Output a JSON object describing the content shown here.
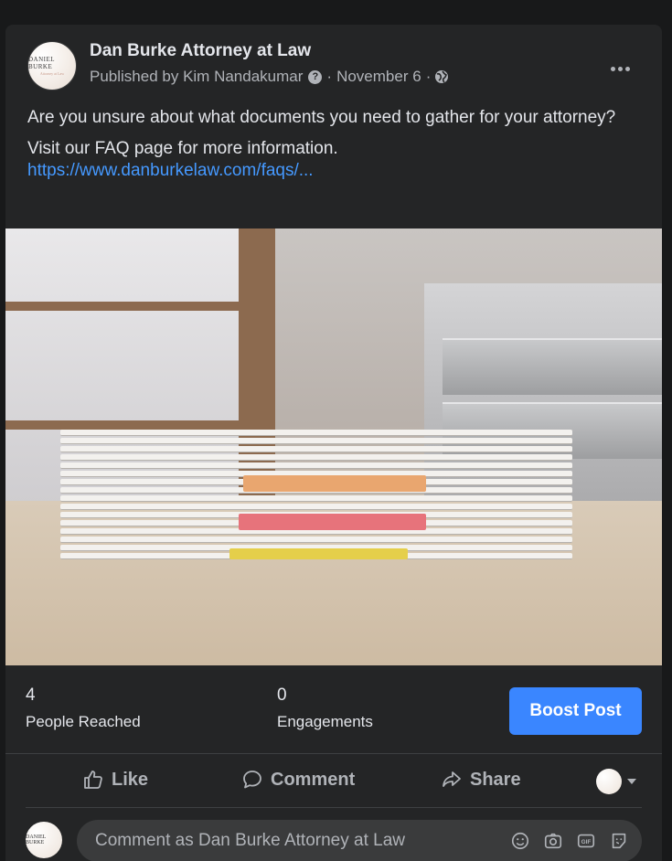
{
  "post": {
    "page_name": "Dan Burke Attorney at Law",
    "avatar_text": "DANIEL BURKE",
    "avatar_subtext": "Attorney at Law",
    "published_by": "Published by Kim Nandakumar",
    "help_icon": "?",
    "separator": "·",
    "date": "November 6",
    "globe_icon": "globe-icon",
    "more_icon": "more-options-icon",
    "text_line1": "Are you unsure about what documents you need to gather for your attorney?",
    "text_line2": "Visit our FAQ page for more information.",
    "link": "https://www.danburkelaw.com/faqs/..."
  },
  "insights": {
    "reached_value": "4",
    "reached_label": "People Reached",
    "engagements_value": "0",
    "engagements_label": "Engagements",
    "boost_label": "Boost Post"
  },
  "actions": {
    "like_label": "Like",
    "comment_label": "Comment",
    "share_label": "Share"
  },
  "comment_box": {
    "placeholder": "Comment as Dan Burke Attorney at Law",
    "icons": [
      "emoji-icon",
      "camera-icon",
      "gif-icon",
      "sticker-icon"
    ]
  },
  "colors": {
    "background": "#18191a",
    "card": "#242526",
    "accent": "#3a86ff",
    "link": "#4599ff"
  }
}
